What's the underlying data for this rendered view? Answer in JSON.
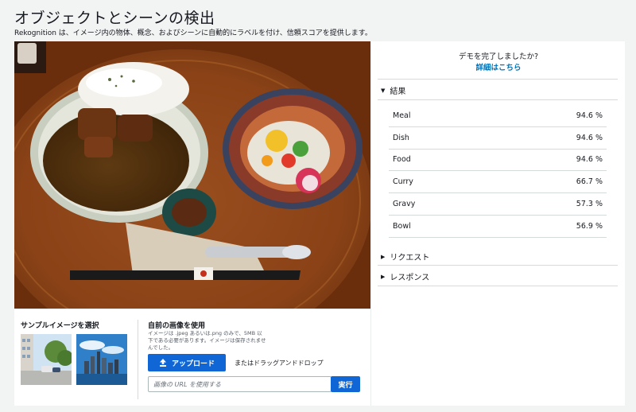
{
  "header": {
    "title": "オブジェクトとシーンの検出",
    "description": "Rekognition は、イメージ内の物体、概念、およびシーンに自動的にラベルを付け、信頼スコアを提供します。"
  },
  "samples": {
    "title": "サンプルイメージを選択"
  },
  "own_image": {
    "title": "自前の画像を使用",
    "note": "イメージは .jpeg あるいは.png のみで、5MB 以下である必要があります。イメージは保存されませんでした。",
    "upload_label": "アップロード",
    "dragdrop_label": "またはドラッグアンドドロップ",
    "url_placeholder": "画像の URL を使用する",
    "run_label": "実行"
  },
  "demo": {
    "question": "デモを完了しましたか?",
    "link": "詳細はこちら"
  },
  "sections": {
    "results": "結果",
    "request": "リクエスト",
    "response": "レスポンス"
  },
  "results": [
    {
      "label": "Meal",
      "value": "94.6 %"
    },
    {
      "label": "Dish",
      "value": "94.6 %"
    },
    {
      "label": "Food",
      "value": "94.6 %"
    },
    {
      "label": "Curry",
      "value": "66.7 %"
    },
    {
      "label": "Gravy",
      "value": "57.3 %"
    },
    {
      "label": "Bowl",
      "value": "56.9 %"
    }
  ],
  "icons": {
    "upload": "upload-icon",
    "caret_open": "caret-down-icon",
    "caret_closed": "caret-right-icon"
  },
  "colors": {
    "accent": "#1066d4",
    "link": "#0073bb",
    "background": "#f2f3f3"
  }
}
